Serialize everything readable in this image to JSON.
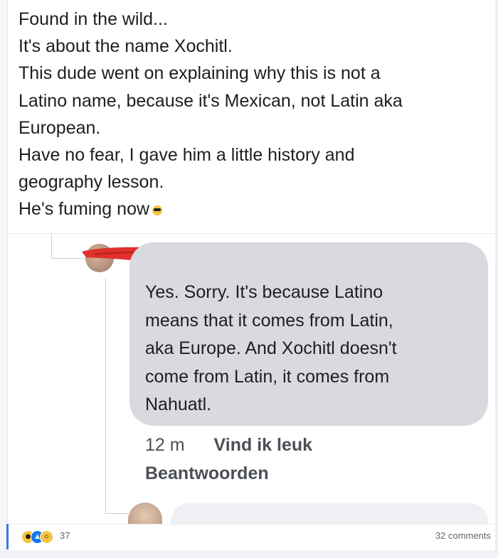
{
  "post": {
    "lines": [
      "Found in the wild...",
      "It's about the name Xochitl.",
      "This dude went on explaining why this is not a",
      "Latino name, because it's Mexican, not Latin aka",
      "European.",
      "Have no fear, I gave him a little history and",
      "geography lesson.",
      "He's fuming now"
    ]
  },
  "comment": {
    "lines": [
      "Yes. Sorry. It's because Latino",
      "means that it comes from Latin,",
      "aka Europe. And Xochitl doesn't",
      "come from Latin, it comes from",
      "Nahuatl."
    ],
    "time": "12 m",
    "like_label": "Vind ik leuk",
    "reply_label": "Beantwoorden"
  },
  "footer": {
    "reaction_count": "37",
    "comments_label": "32 comments"
  },
  "colors": {
    "bubble": "#d8dadf",
    "redaction": "#e0322d",
    "accent": "#3578e5"
  }
}
